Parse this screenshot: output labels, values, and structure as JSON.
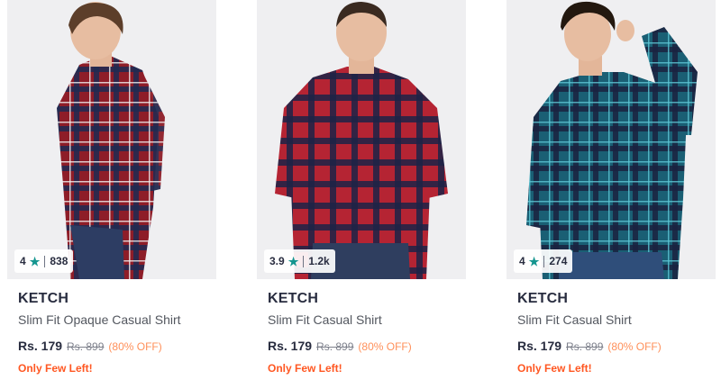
{
  "products": [
    {
      "brand": "KETCH",
      "name": "Slim Fit Opaque Casual Shirt",
      "price": "Rs. 179",
      "mrp": "Rs. 899",
      "discount": "(80% OFF)",
      "stock_note": "Only Few Left!",
      "rating": "4",
      "rating_count": "838",
      "star_icon": "star-icon",
      "shirt_color": "#8e1d28",
      "check_color": "#1e2a52"
    },
    {
      "brand": "KETCH",
      "name": "Slim Fit Casual Shirt",
      "price": "Rs. 179",
      "mrp": "Rs. 899",
      "discount": "(80% OFF)",
      "stock_note": "Only Few Left!",
      "rating": "3.9",
      "rating_count": "1.2k",
      "star_icon": "star-icon",
      "shirt_color": "#b52433",
      "check_color": "#1c2346"
    },
    {
      "brand": "KETCH",
      "name": "Slim Fit Casual Shirt",
      "price": "Rs. 179",
      "mrp": "Rs. 899",
      "discount": "(80% OFF)",
      "stock_note": "Only Few Left!",
      "rating": "4",
      "rating_count": "274",
      "star_icon": "star-icon",
      "shirt_color": "#1a5f74",
      "check_color": "#1a2240"
    }
  ],
  "colors": {
    "rating_star": "#14958f",
    "discount": "#ff905a",
    "stock_note": "#ff5722"
  }
}
